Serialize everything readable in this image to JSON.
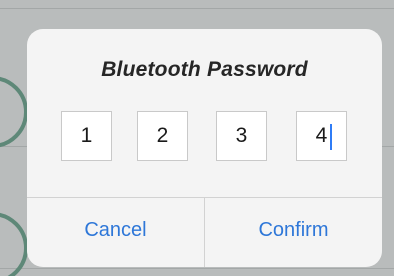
{
  "dialog": {
    "title": "Bluetooth Password",
    "digits": [
      "1",
      "2",
      "3",
      "4"
    ],
    "cancel_label": "Cancel",
    "confirm_label": "Confirm"
  },
  "colors": {
    "accent": "#2e77d8",
    "caret": "#2f7cf6",
    "dialog_background": "#f4f4f4",
    "backdrop": "#b9bcbc"
  }
}
